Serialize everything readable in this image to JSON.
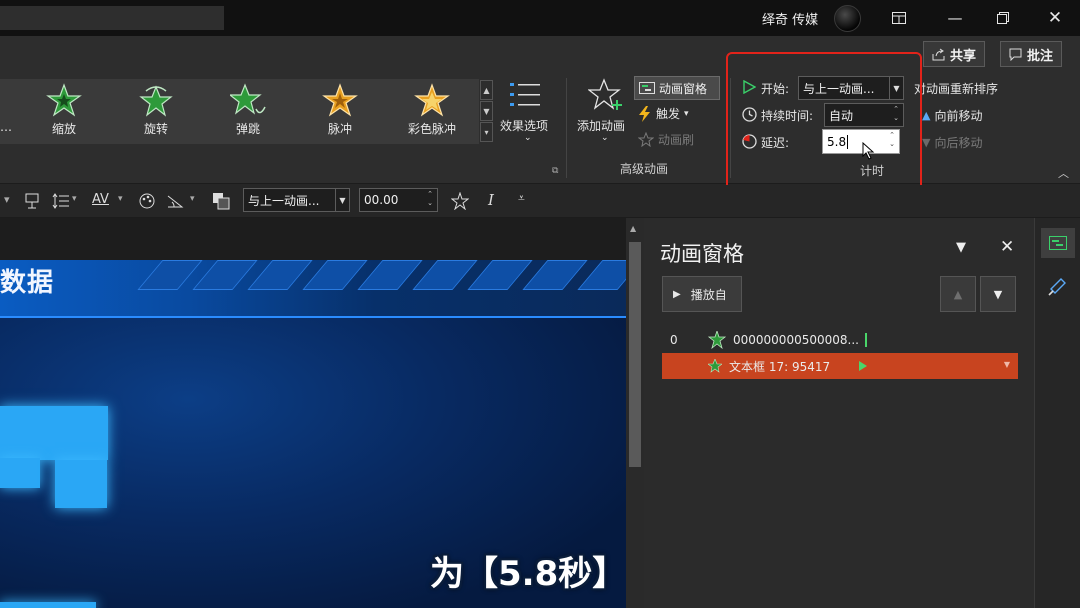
{
  "titlebar": {
    "user_name": "绎奇 传媒"
  },
  "ribbon": {
    "share_label": "共享",
    "comment_label": "批注",
    "gallery_items": [
      {
        "label": "缩放",
        "icon": "zoom-star-icon",
        "color": "#2e9a3a"
      },
      {
        "label": "旋转",
        "icon": "spin-star-icon",
        "color": "#2e9a3a"
      },
      {
        "label": "弹跳",
        "icon": "bounce-star-icon",
        "color": "#2e9a3a"
      },
      {
        "label": "脉冲",
        "icon": "pulse-star-icon",
        "color": "#e8a020"
      },
      {
        "label": "彩色脉冲",
        "icon": "color-pulse-star-icon",
        "color": "#e8a020"
      }
    ],
    "effect_options_label": "效果选项",
    "add_animation_label": "添加动画",
    "animation_pane_label": "动画窗格",
    "trigger_label": "触发",
    "animation_painter_label": "动画刷",
    "advanced_group_label": "高级动画",
    "start_label": "开始:",
    "start_value": "与上一动画...",
    "duration_label": "持续时间:",
    "duration_value": "自动",
    "delay_label": "延迟:",
    "delay_value": "5.8",
    "timing_group_label": "计时",
    "reorder_label": "对动画重新排序",
    "move_earlier_label": "向前移动",
    "move_later_label": "向后移动",
    "row2_start_value": "与上一动画...",
    "row2_delay_value": "00.00"
  },
  "slide": {
    "banner_text": "数据",
    "caption": "为【5.8秒】"
  },
  "animation_pane": {
    "title": "动画窗格",
    "play_label": "播放自",
    "rows": [
      {
        "index": "0",
        "name": "000000000500008...",
        "selected": false
      },
      {
        "index": "",
        "name": "文本框 17: 95417",
        "selected": true
      }
    ]
  },
  "colors": {
    "accent_red": "#e2231a",
    "selected_row": "#c8441f",
    "green_star": "#2e9a3a"
  }
}
